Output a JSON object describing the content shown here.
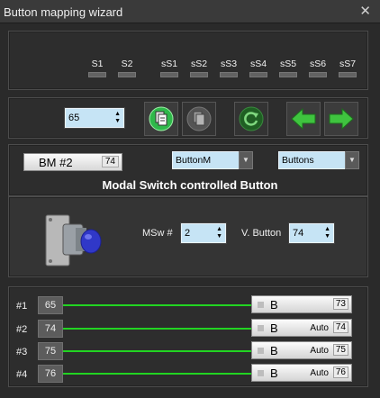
{
  "window": {
    "title": "Button mapping wizard",
    "close_glyph": "✕"
  },
  "switches": [
    {
      "label": "S1"
    },
    {
      "label": "S2"
    },
    {
      "label": "sS1"
    },
    {
      "label": "sS2"
    },
    {
      "label": "sS3"
    },
    {
      "label": "sS4"
    },
    {
      "label": "sS5"
    },
    {
      "label": "sS6"
    },
    {
      "label": "sS7"
    }
  ],
  "toolbar": {
    "spinner_value": "65",
    "paste_icon": "paste-icon",
    "copy_icon": "copy-icon",
    "reset_icon": "reset-icon",
    "prev_icon": "arrow-left-icon",
    "next_icon": "arrow-right-icon"
  },
  "config": {
    "bm_label": "BM #2",
    "bm_number": "74",
    "combo1_value": "ButtonM",
    "combo2_value": "Buttons",
    "heading": "Modal Switch controlled Button",
    "msw_label": "MSw #",
    "msw_value": "2",
    "vbutton_label": "V. Button",
    "vbutton_value": "74"
  },
  "rows": [
    {
      "label": "#1",
      "value": "65",
      "button": "B",
      "auto": "",
      "number": "73"
    },
    {
      "label": "#2",
      "value": "74",
      "button": "B",
      "auto": "Auto",
      "number": "74"
    },
    {
      "label": "#3",
      "value": "75",
      "button": "B",
      "auto": "Auto",
      "number": "75"
    },
    {
      "label": "#4",
      "value": "76",
      "button": "B",
      "auto": "Auto",
      "number": "76"
    }
  ],
  "colors": {
    "accent_green": "#22d422",
    "field_blue": "#c6e4f5",
    "panel_bg": "#2d2d2d"
  }
}
